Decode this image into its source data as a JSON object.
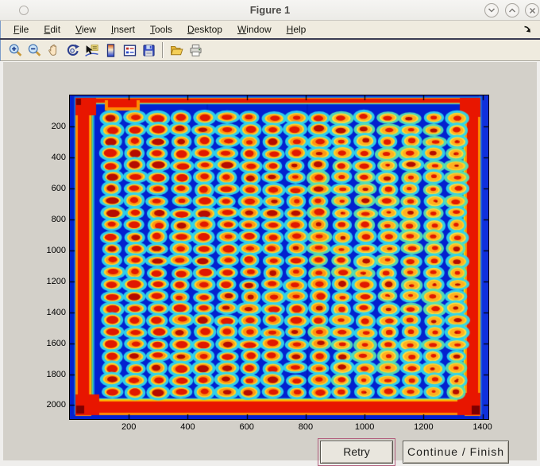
{
  "window": {
    "title": "Figure 1",
    "controls": {
      "shade": "chevron-down",
      "maximize": "chevron-up",
      "close": "x"
    }
  },
  "menu": {
    "items": [
      "File",
      "Edit",
      "View",
      "Insert",
      "Tools",
      "Desktop",
      "Window",
      "Help"
    ]
  },
  "toolbar": {
    "buttons": [
      "Zoom In",
      "Zoom Out",
      "Pan",
      "Rotate 3D",
      "Data Cursor",
      "Insert Colorbar",
      "Insert Legend",
      "Save Figure",
      "Open File",
      "Print Figure"
    ]
  },
  "actions": {
    "retry_label": "Retry",
    "continue_label": "Continue / Finish"
  },
  "chart_data": {
    "type": "heatmap",
    "title": "",
    "xlabel": "",
    "ylabel": "",
    "description": "Pseudocolor (jet colormap) scan of a microarray plate: dense grid of spots with red/orange centers, yellow rings and cyan halos on a deep blue background, framed by saturated red edge bands along all four borders of the scanned plate.",
    "colormap": "jet",
    "x_range": [
      0,
      1420
    ],
    "y_range": [
      0,
      2090
    ],
    "x_ticks": [
      200,
      400,
      600,
      800,
      1000,
      1200,
      1400
    ],
    "y_ticks": [
      200,
      400,
      600,
      800,
      1000,
      1200,
      1400,
      1600,
      1800,
      2000
    ],
    "grid": {
      "cols": 16,
      "rows": 24,
      "x_first": 143,
      "x_spacing": 78,
      "y_first": 144,
      "y_spacing": 77,
      "spot_rx": 28,
      "spot_ry": 32
    },
    "colors": {
      "background": "#0321cf",
      "background_right_strip": "#1030dc",
      "edge_band": "#e81600",
      "edge_fringe_orange": "#ff8c00",
      "edge_fringe_yellow": "#ffe000",
      "edge_fringe_green": "#50e080",
      "halo_cyan": "#32d7eb",
      "halo_green": "#55e2b4",
      "ring_yellow": "#ffd428",
      "ring_orange": "#ff9612",
      "center_red": "#e01800",
      "center_dark_red": "#b40c00",
      "corner_maroon": "#7d0000",
      "figure_background": "#d3d0c9"
    },
    "legend": "none",
    "grid_lines": "off"
  }
}
